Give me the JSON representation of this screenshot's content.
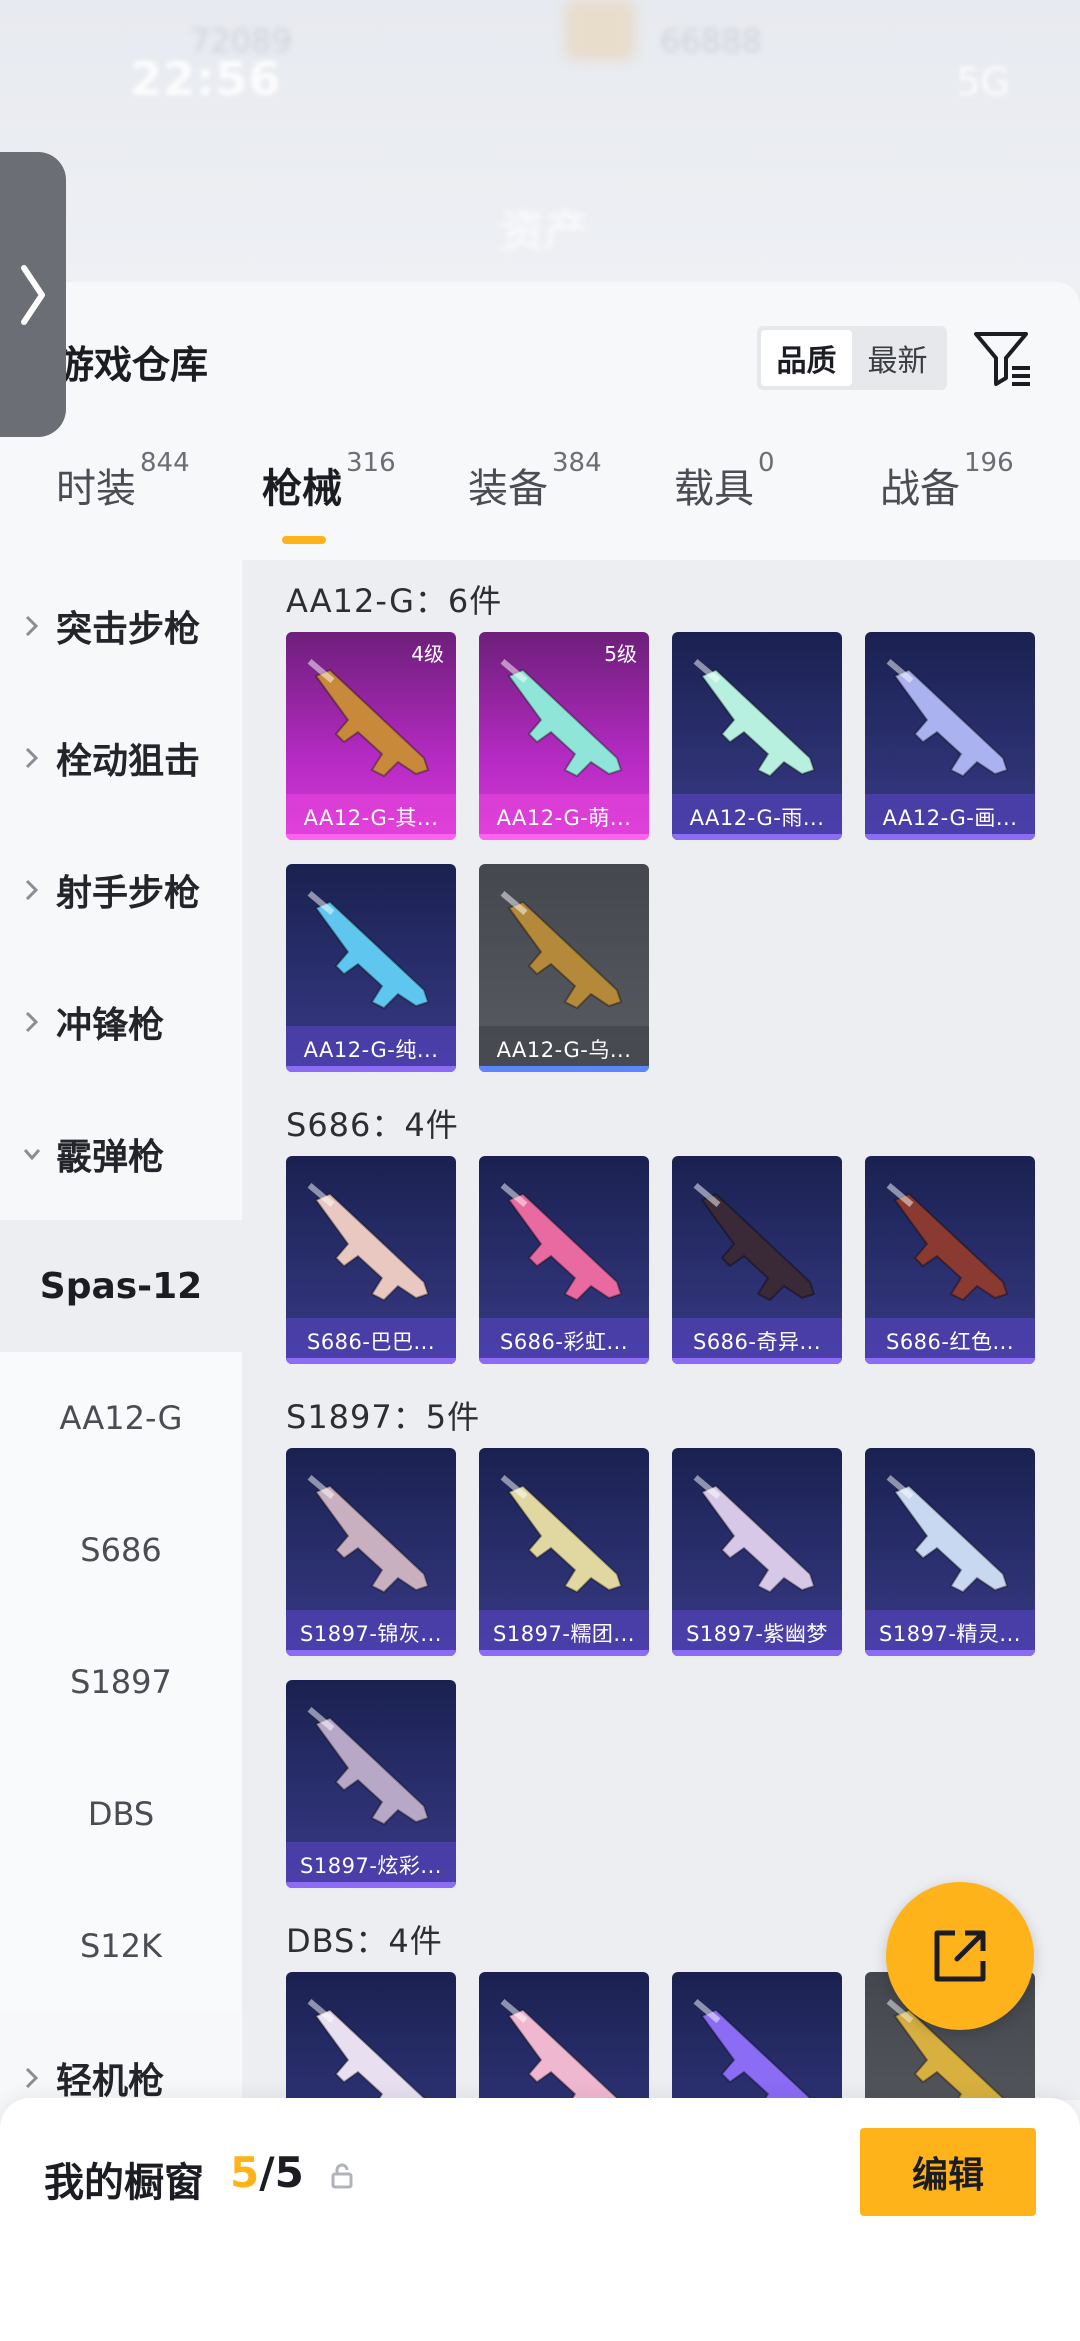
{
  "status_bar": {
    "time": "22:56",
    "network": "5G",
    "blurred_left": "72089",
    "blurred_right": "66888"
  },
  "header_blur": {
    "page_title": "资产"
  },
  "panel": {
    "title": "游戏仓库",
    "sort": {
      "quality": "品质",
      "newest": "最新",
      "active": "quality"
    }
  },
  "tabs": [
    {
      "label": "时装",
      "count": "844"
    },
    {
      "label": "枪械",
      "count": "316",
      "active": true
    },
    {
      "label": "装备",
      "count": "384"
    },
    {
      "label": "载具",
      "count": "0"
    },
    {
      "label": "战备",
      "count": "196"
    }
  ],
  "categories": [
    {
      "label": "突击步枪",
      "expanded": false
    },
    {
      "label": "栓动狙击",
      "expanded": false
    },
    {
      "label": "射手步枪",
      "expanded": false
    },
    {
      "label": "冲锋枪",
      "expanded": false
    },
    {
      "label": "霰弹枪",
      "expanded": true
    }
  ],
  "subcategories": [
    "Spas-12",
    "AA12-G",
    "S686",
    "S1897",
    "DBS",
    "S12K"
  ],
  "selected_subcategory": "Spas-12",
  "last_category": {
    "label": "轻机枪"
  },
  "sections": [
    {
      "title": "AA12-G：6件",
      "items": [
        {
          "name": "AA12-G-其...",
          "level": "4级",
          "rarity": "pink",
          "color": "#c88a3a"
        },
        {
          "name": "AA12-G-萌...",
          "level": "5级",
          "rarity": "pink",
          "color": "#8fe6d8"
        },
        {
          "name": "AA12-G-雨...",
          "level": "",
          "rarity": "purple",
          "color": "#b8f0e0"
        },
        {
          "name": "AA12-G-画...",
          "level": "",
          "rarity": "purple",
          "color": "#aab2f0"
        },
        {
          "name": "AA12-G-纯...",
          "level": "",
          "rarity": "purple",
          "color": "#5fc6f0"
        },
        {
          "name": "AA12-G-乌...",
          "level": "",
          "rarity": "gray",
          "color": "#b48a3a"
        }
      ]
    },
    {
      "title": "S686：4件",
      "items": [
        {
          "name": "S686-巴巴...",
          "rarity": "purple",
          "color": "#e8c8c0"
        },
        {
          "name": "S686-彩虹...",
          "rarity": "purple",
          "color": "#e86aa0"
        },
        {
          "name": "S686-奇异...",
          "rarity": "purple",
          "color": "#3a2a38"
        },
        {
          "name": "S686-红色...",
          "rarity": "purple",
          "color": "#8a3a30"
        }
      ]
    },
    {
      "title": "S1897：5件",
      "items": [
        {
          "name": "S1897-锦灰...",
          "rarity": "purple",
          "color": "#c8b0c0"
        },
        {
          "name": "S1897-糯团...",
          "rarity": "purple",
          "color": "#e0d8a0"
        },
        {
          "name": "S1897-紫幽梦",
          "rarity": "purple",
          "color": "#d8c8e8"
        },
        {
          "name": "S1897-精灵...",
          "rarity": "purple",
          "color": "#c8d8f0"
        },
        {
          "name": "S1897-炫彩...",
          "rarity": "purple",
          "color": "#b8a8c8"
        }
      ]
    },
    {
      "title": "DBS：4件",
      "items": [
        {
          "name": "",
          "rarity": "purple",
          "color": "#e8e0f0"
        },
        {
          "name": "",
          "rarity": "purple",
          "color": "#f0b8d0"
        },
        {
          "name": "",
          "rarity": "purple",
          "color": "#8a6cf5"
        },
        {
          "name": "",
          "rarity": "gray",
          "color": "#d8b040"
        }
      ]
    }
  ],
  "showcase": {
    "label": "我的橱窗",
    "current": "5",
    "total": "/5",
    "edit": "编辑"
  },
  "colors": {
    "accent": "#ffb31a",
    "pink_rarity": "#d739d6",
    "purple_rarity": "#2a2f6e"
  },
  "icons": {
    "filter": "filter-icon",
    "share": "share-icon",
    "lock": "lock-icon",
    "drawer": "chevron-right-icon"
  }
}
